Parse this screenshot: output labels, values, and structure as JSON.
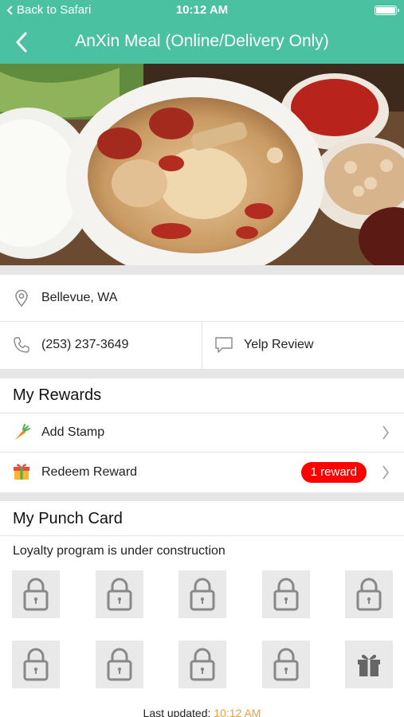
{
  "status": {
    "back_label": "Back to Safari",
    "time": "10:12 AM"
  },
  "nav": {
    "title": "AnXin Meal (Online/Delivery Only)"
  },
  "location": {
    "address": "Bellevue, WA"
  },
  "contact": {
    "phone": "(253) 237-3649",
    "review_label": "Yelp Review"
  },
  "rewards": {
    "title": "My Rewards",
    "add_stamp": "Add Stamp",
    "redeem": "Redeem Reward",
    "badge": "1 reward"
  },
  "punch": {
    "title": "My Punch Card",
    "status": "Loyalty program is under construction"
  },
  "footer": {
    "label": "Last updated:",
    "time": "10:12 AM"
  },
  "colors": {
    "brand": "#4ac1a0",
    "badge": "#ff0000",
    "timestamp": "#f0a030"
  }
}
